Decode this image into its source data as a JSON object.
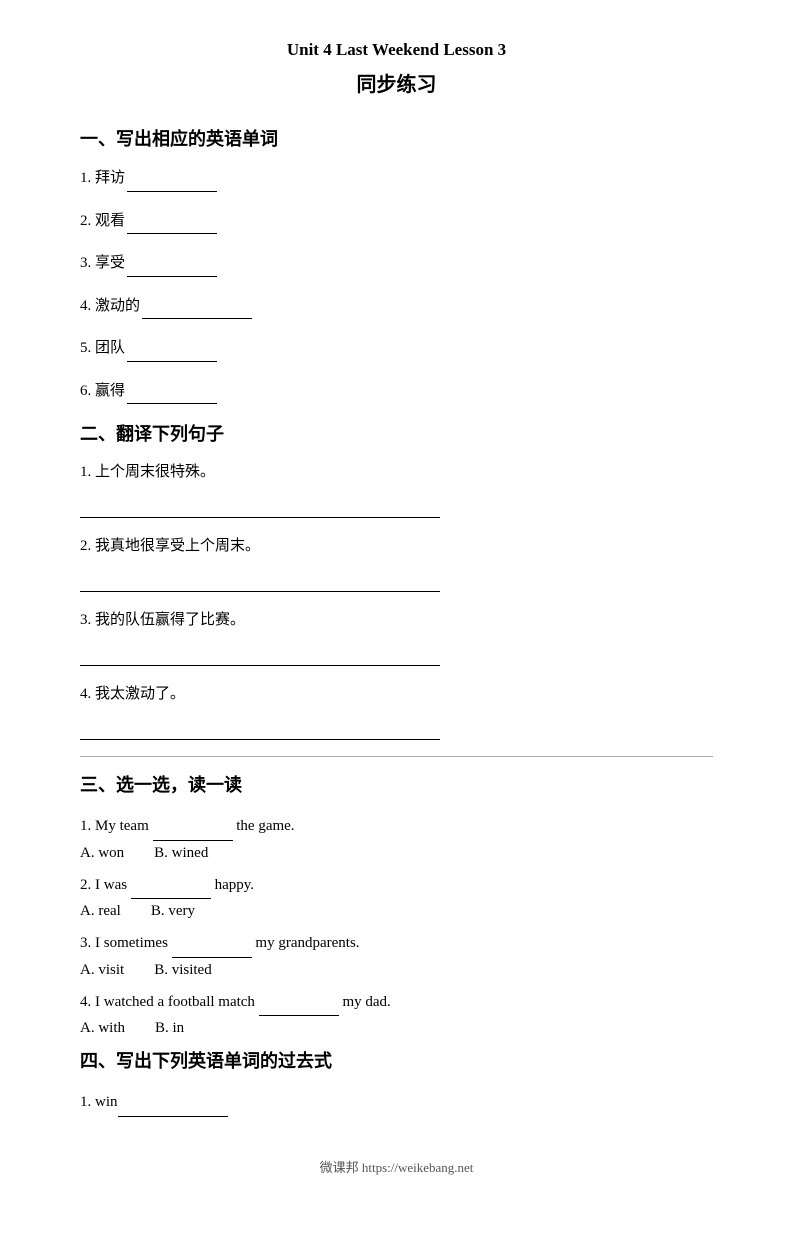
{
  "header": {
    "title_en": "Unit 4 Last Weekend Lesson 3",
    "title_cn": "同步练习"
  },
  "section1": {
    "title": "一、写出相应的英语单词",
    "items": [
      {
        "num": "1.",
        "text": "拜访",
        "blank_size": "normal"
      },
      {
        "num": "2.",
        "text": "观看",
        "blank_size": "normal"
      },
      {
        "num": "3.",
        "text": "享受",
        "blank_size": "normal"
      },
      {
        "num": "4.",
        "text": "激动的",
        "blank_size": "large"
      },
      {
        "num": "5.",
        "text": "团队",
        "blank_size": "normal"
      },
      {
        "num": "6.",
        "text": "赢得",
        "blank_size": "normal"
      }
    ]
  },
  "section2": {
    "title": "二、翻译下列句子",
    "items": [
      {
        "num": "1.",
        "text": "上个周末很特殊。"
      },
      {
        "num": "2.",
        "text": "我真地很享受上个周末。"
      },
      {
        "num": "3.",
        "text": "我的队伍赢得了比赛。"
      },
      {
        "num": "4.",
        "text": "我太激动了。"
      }
    ]
  },
  "section3": {
    "title": "三、选一选，读一读",
    "questions": [
      {
        "num": "1.",
        "before": "My team",
        "blank": true,
        "after": "the game.",
        "options": [
          {
            "label": "A.",
            "value": "won"
          },
          {
            "label": "B.",
            "value": "wined"
          }
        ]
      },
      {
        "num": "2.",
        "before": "I was",
        "blank": true,
        "after": "happy.",
        "options": [
          {
            "label": "A.",
            "value": "real"
          },
          {
            "label": "B.",
            "value": "very"
          }
        ]
      },
      {
        "num": "3.",
        "before": "I sometimes",
        "blank": true,
        "after": "my grandparents.",
        "options": [
          {
            "label": "A.",
            "value": "visit"
          },
          {
            "label": "B.",
            "value": "visited"
          }
        ]
      },
      {
        "num": "4.",
        "before": "I watched a football match",
        "blank": true,
        "after": "my dad.",
        "options": [
          {
            "label": "A.",
            "value": "with"
          },
          {
            "label": "B.",
            "value": "in"
          }
        ]
      }
    ]
  },
  "section4": {
    "title": "四、写出下列英语单词的过去式",
    "items": [
      {
        "num": "1.",
        "text": "win",
        "blank_size": "large"
      }
    ]
  },
  "footer": {
    "text": "微课邦 https://weikebang.net"
  }
}
